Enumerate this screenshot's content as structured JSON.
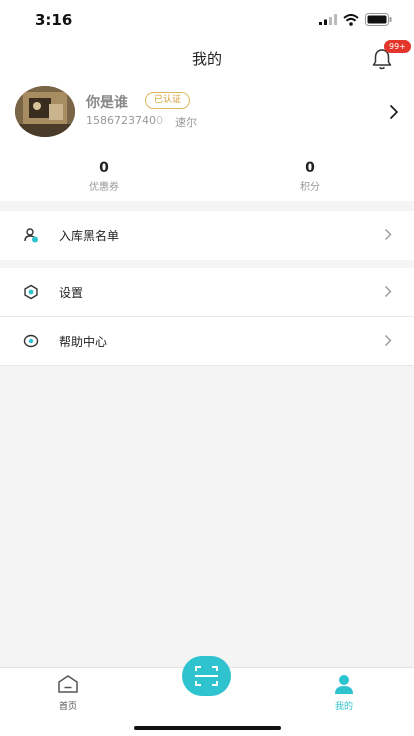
{
  "status_bar": {
    "time": "3:16"
  },
  "nav": {
    "title": "我的",
    "notification_badge": "99+"
  },
  "profile": {
    "name": "你是谁",
    "verified_label": "已认证",
    "phone": "1586723740",
    "phone_faded_tail": "0",
    "region": "速尔"
  },
  "stats": [
    {
      "value": "0",
      "label": "优惠券"
    },
    {
      "value": "0",
      "label": "积分"
    }
  ],
  "menu": [
    {
      "label": "入库黑名单",
      "icon": "user-block-icon"
    },
    {
      "label": "设置",
      "icon": "settings-hexagon-icon"
    },
    {
      "label": "帮助中心",
      "icon": "help-icon"
    }
  ],
  "tab_bar": {
    "tabs": [
      {
        "label": "首页",
        "icon": "home-icon",
        "active": false
      },
      {
        "label": "我的",
        "icon": "person-icon",
        "active": true
      }
    ],
    "scan_icon": "scan-icon"
  },
  "colors": {
    "accent": "#2ec3cf",
    "badge": "#e3352b",
    "verified": "#d49c2c",
    "background": "#f4f4f4"
  }
}
